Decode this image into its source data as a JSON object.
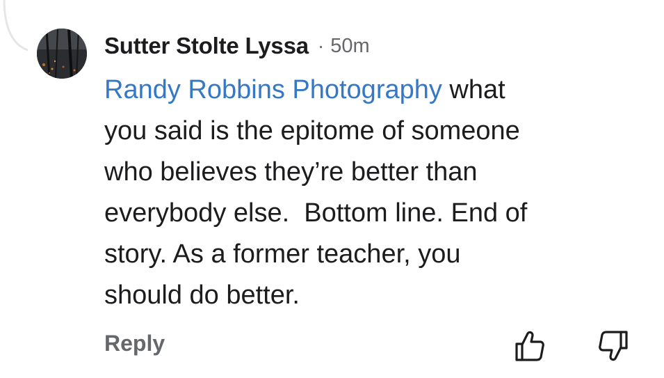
{
  "comment": {
    "author": "Sutter Stolte Lyssa",
    "separator": "·",
    "timestamp": "50m",
    "mention": "Randy Robbins Photography",
    "lines": {
      "l1_rest": " what",
      "l2": "you said is the epitome of someone",
      "l3": "who believes they’re better than",
      "l4": "everybody else.  Bottom line. End of",
      "l5": "story. As a former teacher, you",
      "l6": "should do better."
    },
    "reply_label": "Reply"
  },
  "icons": {
    "avatar": "profile-photo-dark-forest",
    "like": "thumbs-up-outline-icon",
    "dislike": "thumbs-down-outline-icon"
  },
  "colors": {
    "mention": "#3578c6",
    "secondary_text": "#65676b",
    "primary_text": "#1c1c1e"
  }
}
